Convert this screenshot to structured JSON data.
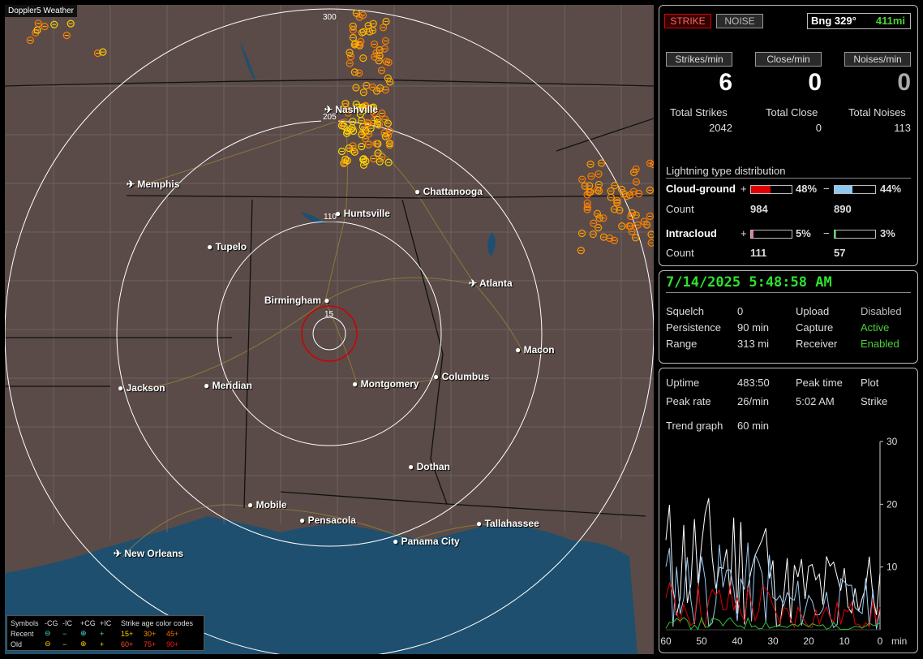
{
  "app_title": "Doppler5 Weather",
  "cities": [
    {
      "name": "Nashville",
      "icon": "airport"
    },
    {
      "name": "Memphis",
      "icon": "airport"
    },
    {
      "name": "Chattanooga",
      "icon": "dot"
    },
    {
      "name": "Huntsville",
      "icon": "dot"
    },
    {
      "name": "Tupelo",
      "icon": "dot"
    },
    {
      "name": "Atlanta",
      "icon": "airport"
    },
    {
      "name": "Birmingham",
      "icon": "dot"
    },
    {
      "name": "Macon",
      "icon": "dot"
    },
    {
      "name": "Jackson",
      "icon": "dot"
    },
    {
      "name": "Meridian",
      "icon": "dot"
    },
    {
      "name": "Montgomery",
      "icon": "dot"
    },
    {
      "name": "Columbus",
      "icon": "dot"
    },
    {
      "name": "Dothan",
      "icon": "dot"
    },
    {
      "name": "Mobile",
      "icon": "dot"
    },
    {
      "name": "Pensacola",
      "icon": "dot"
    },
    {
      "name": "Tallahassee",
      "icon": "dot"
    },
    {
      "name": "Panama City",
      "icon": "dot"
    },
    {
      "name": "New Orleans",
      "icon": "airport"
    }
  ],
  "range_rings": [
    "300",
    "205",
    "110",
    "15"
  ],
  "legend": {
    "header": [
      "Symbols",
      "-CG",
      "-IC",
      "+CG",
      "+IC",
      "Strike age color codes"
    ],
    "recent": {
      "label": "Recent",
      "ages": [
        "15+",
        "30+",
        "45+"
      ]
    },
    "old": {
      "label": "Old",
      "ages": [
        "60+",
        "75+",
        "90+"
      ]
    }
  },
  "top": {
    "strike": "STRIKE",
    "noise": "NOISE",
    "bearing": "Bng 329°",
    "distance": "411mi"
  },
  "rates": [
    {
      "label": "Strikes/min",
      "value": "6",
      "total_label": "Total Strikes",
      "total": "2042"
    },
    {
      "label": "Close/min",
      "value": "0",
      "total_label": "Total Close",
      "total": "0"
    },
    {
      "label": "Noises/min",
      "value": "0",
      "total_label": "Total Noises",
      "total": "113"
    }
  ],
  "distribution": {
    "title": "Lightning type distribution",
    "cg_label": "Cloud-ground",
    "cg_pos_pct": "48%",
    "cg_neg_pct": "44%",
    "cg_pos_count": "984",
    "cg_neg_count": "890",
    "ic_label": "Intracloud",
    "ic_pos_pct": "5%",
    "ic_neg_pct": "3%",
    "ic_pos_count": "111",
    "ic_neg_count": "57",
    "count_label": "Count",
    "plus": "+",
    "minus": "−",
    "fractions": {
      "cg_pos": 0.48,
      "cg_neg": 0.44,
      "ic_pos": 0.05,
      "ic_neg": 0.03
    }
  },
  "status": {
    "datetime": "7/14/2025 5:48:58 AM",
    "rows": [
      {
        "k1": "Squelch",
        "v1": "0",
        "k2": "Upload",
        "v2": "Disabled"
      },
      {
        "k1": "Persistence",
        "v1": "90 min",
        "k2": "Capture",
        "v2": "Active"
      },
      {
        "k1": "Range",
        "v1": "313 mi",
        "k2": "Receiver",
        "v2": "Enabled"
      }
    ]
  },
  "stats": {
    "uptime_label": "Uptime",
    "uptime": "483:50",
    "peak_time_label": "Peak time",
    "plot_label": "Plot",
    "peak_rate_label": "Peak rate",
    "peak_rate": "26/min",
    "peak_time": "5:02 AM",
    "plot": "Strike",
    "trend_label": "Trend graph",
    "trend": "60 min"
  },
  "chart_data": {
    "type": "line",
    "x_ticks": [
      "60",
      "50",
      "40",
      "30",
      "20",
      "10",
      "0"
    ],
    "x_unit": "min",
    "y_ticks": [
      "30",
      "20",
      "10"
    ],
    "ylim": [
      0,
      30
    ]
  },
  "colors": {
    "strike_recent": "#ffd000",
    "strike_old": "#ff8c00",
    "ring": "#ffffff",
    "ring_red": "#d00000",
    "water": "#1f4f6e",
    "state_line": "#111111"
  }
}
